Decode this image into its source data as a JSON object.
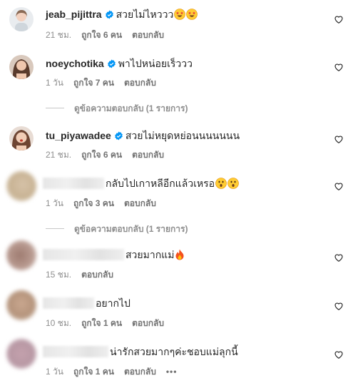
{
  "comments": [
    {
      "username": "jeab_pijittra",
      "verified": true,
      "text": "สวยไม่ไหววว",
      "emoji": [
        "star-struck-icon",
        "star-struck-icon"
      ],
      "time": "21 ชม.",
      "likes": "ถูกใจ 6 คน",
      "reply": "ตอบกลับ"
    },
    {
      "username": "noeychotika",
      "verified": true,
      "text": "พาไปหน่อยเร็ววว",
      "time": "1 วัน",
      "likes": "ถูกใจ 7 คน",
      "reply": "ตอบกลับ",
      "view_replies": "ดูข้อความตอบกลับ (1 รายการ)"
    },
    {
      "username": "tu_piyawadee",
      "verified": true,
      "text": "สวยไม่หยุดหย่อนนนนนนน",
      "time": "21 ชม.",
      "likes": "ถูกใจ 6 คน",
      "reply": "ตอบกลับ"
    },
    {
      "username": "",
      "verified": false,
      "text": "กลับไปเกาหลีอีกแล้วเหรอ",
      "emoji": [
        "astonished-face-icon",
        "astonished-face-icon"
      ],
      "time": "1 วัน",
      "likes": "ถูกใจ 3 คน",
      "reply": "ตอบกลับ",
      "view_replies": "ดูข้อความตอบกลับ (1 รายการ)"
    },
    {
      "username": "",
      "verified": false,
      "text": "สวยมากแม่",
      "emoji": [
        "fire-icon"
      ],
      "time": "15 ชม.",
      "reply": "ตอบกลับ"
    },
    {
      "username": "",
      "verified": false,
      "text": "อยากไป",
      "time": "10 ชม.",
      "likes": "ถูกใจ 1 คน",
      "reply": "ตอบกลับ"
    },
    {
      "username": "",
      "verified": false,
      "text": "น่ารักสวยมากๆค่ะชอบแม่ลุกนี้",
      "time": "1 วัน",
      "likes": "ถูกใจ 1 คน",
      "reply": "ตอบกลับ",
      "more": "•••"
    }
  ],
  "colors": {
    "text": "#262626",
    "meta": "#8e8e8e",
    "verified": "#0095f6"
  }
}
